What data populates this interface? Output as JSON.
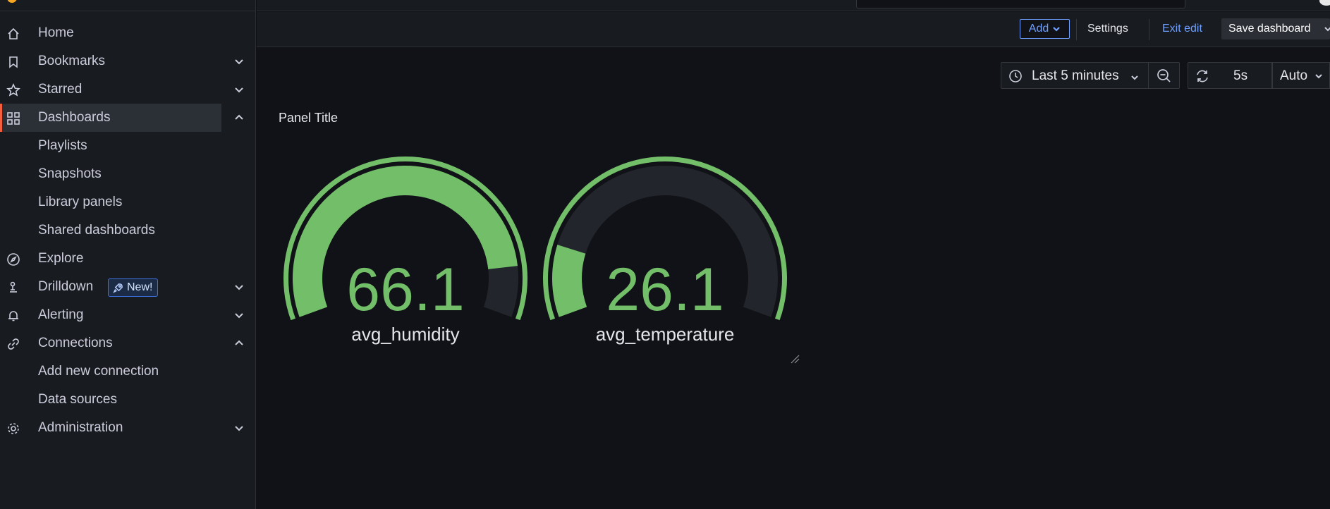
{
  "sidebar": {
    "items": [
      {
        "label": "Home",
        "icon": "home-icon"
      },
      {
        "label": "Bookmarks",
        "icon": "bookmark-icon",
        "chevron": "down"
      },
      {
        "label": "Starred",
        "icon": "star-icon",
        "chevron": "down"
      },
      {
        "label": "Dashboards",
        "icon": "apps-icon",
        "chevron": "up",
        "active": true
      },
      {
        "label": "Playlists",
        "sub": true
      },
      {
        "label": "Snapshots",
        "sub": true
      },
      {
        "label": "Library panels",
        "sub": true
      },
      {
        "label": "Shared dashboards",
        "sub": true
      },
      {
        "label": "Explore",
        "icon": "compass-icon"
      },
      {
        "label": "Drilldown",
        "icon": "drilldown-icon",
        "chevron": "down",
        "badge": "New!"
      },
      {
        "label": "Alerting",
        "icon": "bell-icon",
        "chevron": "down"
      },
      {
        "label": "Connections",
        "icon": "link-icon",
        "chevron": "up"
      },
      {
        "label": "Add new connection",
        "sub": true
      },
      {
        "label": "Data sources",
        "sub": true
      },
      {
        "label": "Administration",
        "icon": "cog-icon",
        "chevron": "down"
      }
    ]
  },
  "toolbar": {
    "add_label": "Add",
    "settings_label": "Settings",
    "exit_edit_label": "Exit edit",
    "save_label": "Save dashboard"
  },
  "time_controls": {
    "range_label": "Last 5 minutes",
    "refresh_interval": "5s",
    "auto_label": "Auto"
  },
  "panel": {
    "title": "Panel Title",
    "gauges": [
      {
        "name": "avg_humidity",
        "value": "66.1",
        "fill_fraction": 0.88,
        "threshold_start_fraction": 0.0
      },
      {
        "name": "avg_temperature",
        "value": "26.1",
        "fill_fraction": 0.17,
        "threshold_start_fraction": 0.0
      }
    ]
  },
  "colors": {
    "background": "#111217",
    "panel_bg": "#181b1f",
    "gauge_fill": "#73bf69",
    "gauge_track": "#22252b",
    "accent_blue": "#6e9fff",
    "active_indicator": "#f55f3e"
  }
}
